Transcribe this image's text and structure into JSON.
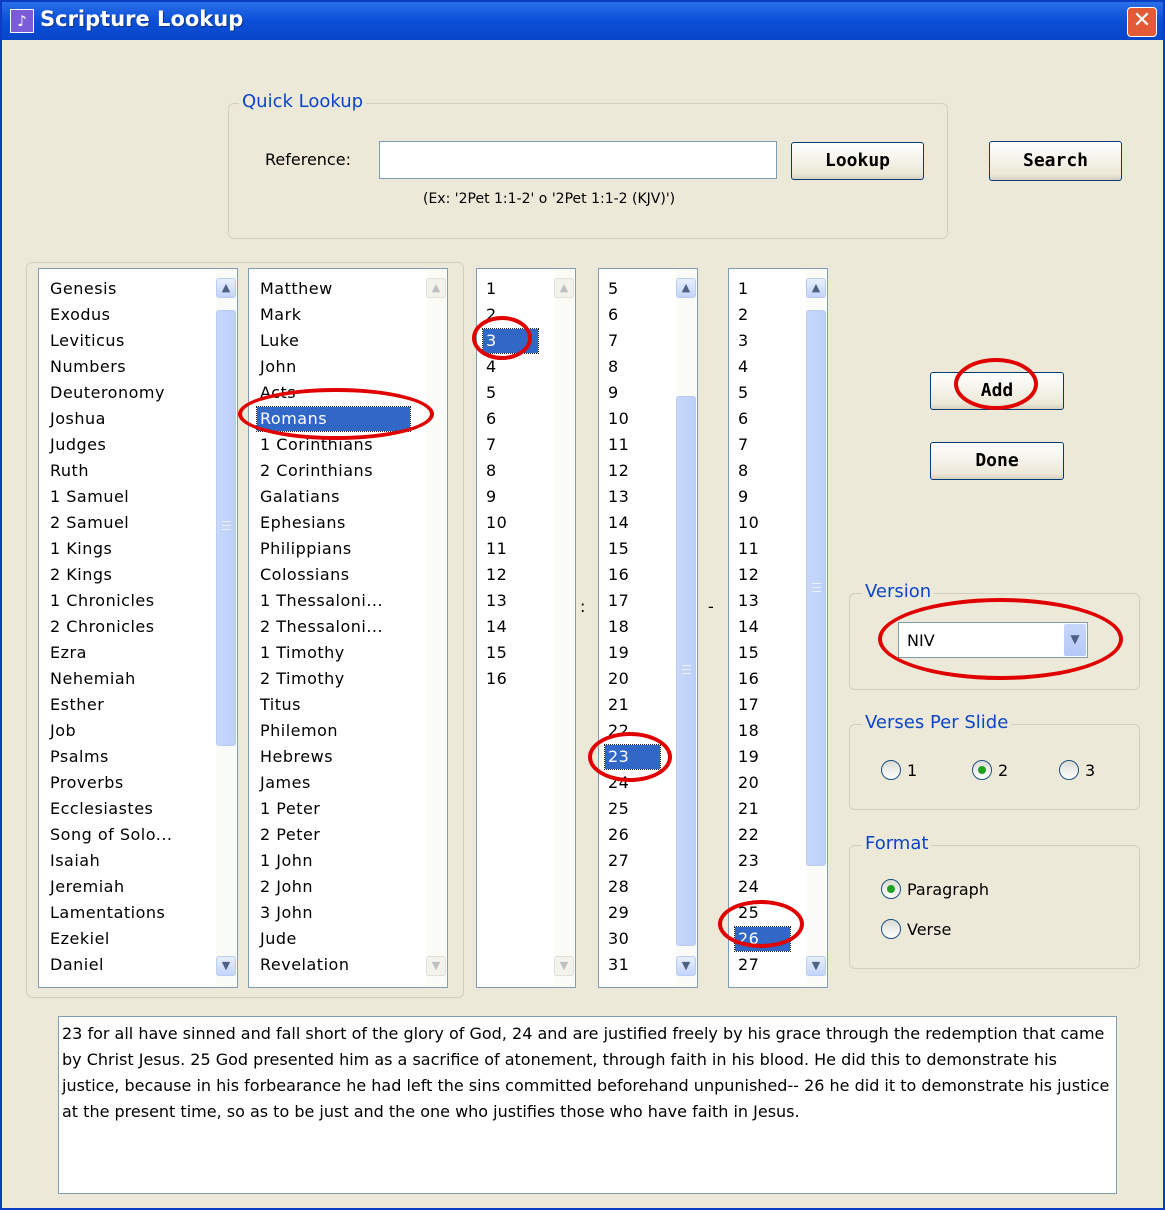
{
  "window": {
    "title": "Scripture Lookup",
    "close_symbol": "✕"
  },
  "quick_lookup": {
    "legend": "Quick Lookup",
    "reference_label": "Reference:",
    "reference_value": "",
    "lookup_button": "Lookup",
    "hint": "(Ex: '2Pet 1:1-2' o '2Pet 1:1-2 (KJV)')"
  },
  "search_button": "Search",
  "ot_books": [
    "Genesis",
    "Exodus",
    "Leviticus",
    "Numbers",
    "Deuteronomy",
    "Joshua",
    "Judges",
    "Ruth",
    "1 Samuel",
    "2 Samuel",
    "1 Kings",
    "2 Kings",
    "1 Chronicles",
    "2 Chronicles",
    "Ezra",
    "Nehemiah",
    "Esther",
    "Job",
    "Psalms",
    "Proverbs",
    "Ecclesiastes",
    "Song of Solo...",
    "Isaiah",
    "Jeremiah",
    "Lamentations",
    "Ezekiel",
    "Daniel"
  ],
  "nt_books": [
    "Matthew",
    "Mark",
    "Luke",
    "John",
    "Acts",
    "Romans",
    "1 Corinthians",
    "2 Corinthians",
    "Galatians",
    "Ephesians",
    "Philippians",
    "Colossians",
    "1 Thessaloni...",
    "2 Thessaloni...",
    "1 Timothy",
    "2 Timothy",
    "Titus",
    "Philemon",
    "Hebrews",
    "James",
    "1 Peter",
    "2 Peter",
    "1 John",
    "2 John",
    "3 John",
    "Jude",
    "Revelation"
  ],
  "selected_book": "Romans",
  "chapters": [
    "1",
    "2",
    "3",
    "4",
    "5",
    "6",
    "7",
    "8",
    "9",
    "10",
    "11",
    "12",
    "13",
    "14",
    "15",
    "16"
  ],
  "selected_chapter": "3",
  "start_verses": [
    "5",
    "6",
    "7",
    "8",
    "9",
    "10",
    "11",
    "12",
    "13",
    "14",
    "15",
    "16",
    "17",
    "18",
    "19",
    "20",
    "21",
    "22",
    "23",
    "24",
    "25",
    "26",
    "27",
    "28",
    "29",
    "30",
    "31"
  ],
  "selected_start_verse": "23",
  "end_verses": [
    "1",
    "2",
    "3",
    "4",
    "5",
    "6",
    "7",
    "8",
    "9",
    "10",
    "11",
    "12",
    "13",
    "14",
    "15",
    "16",
    "17",
    "18",
    "19",
    "20",
    "21",
    "22",
    "23",
    "24",
    "25",
    "26",
    "27"
  ],
  "selected_end_verse": "26",
  "colon": ":",
  "dash": "-",
  "add_button": "Add",
  "done_button": "Done",
  "version": {
    "legend": "Version",
    "value": "NIV"
  },
  "verses_per_slide": {
    "legend": "Verses Per Slide",
    "options": [
      "1",
      "2",
      "3"
    ],
    "selected": "2"
  },
  "format": {
    "legend": "Format",
    "options": [
      "Paragraph",
      "Verse"
    ],
    "selected": "Paragraph"
  },
  "preview_text": "23 for all have sinned and fall short of the glory of God, 24 and are justified freely by his grace through the redemption that came by Christ Jesus. 25 God presented him as a sacrifice of atonement, through faith in his blood. He did this to demonstrate his justice, because in his forbearance he had left the sins committed beforehand unpunished-- 26 he did it to demonstrate his justice at the present time, so as to be just and the one who justifies those who have faith in Jesus.",
  "colors": {
    "selection": "#3168c8",
    "legend": "#0c44c8",
    "annotation": "#e00000"
  }
}
